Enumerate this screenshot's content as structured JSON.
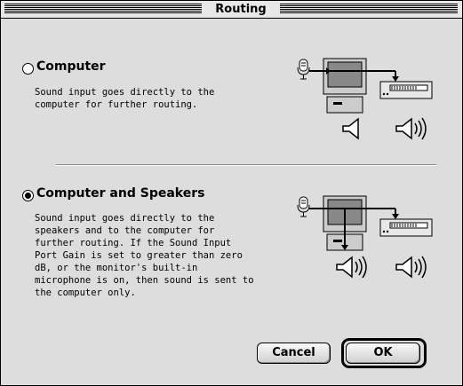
{
  "window": {
    "title": "Routing"
  },
  "options": [
    {
      "label": "Computer",
      "selected": false,
      "description": "Sound input goes directly to the\ncomputer for further routing."
    },
    {
      "label": "Computer and Speakers",
      "selected": true,
      "description": "Sound input goes directly to the\nspeakers and to the computer for\nfurther routing. If the Sound Input\nPort Gain is set to greater than zero\ndB, or the monitor's built-in\nmicrophone is on, then sound is sent to\nthe computer only."
    }
  ],
  "buttons": {
    "cancel": "Cancel",
    "ok": "OK"
  },
  "diagrams": [
    {
      "icons": [
        "microphone-icon",
        "monitor-icon",
        "external-speaker-icon",
        "speaker-muted-icon",
        "speaker-on-icon"
      ]
    },
    {
      "icons": [
        "microphone-icon",
        "monitor-icon",
        "external-speaker-icon",
        "speaker-on-icon",
        "speaker-on-icon"
      ]
    }
  ]
}
